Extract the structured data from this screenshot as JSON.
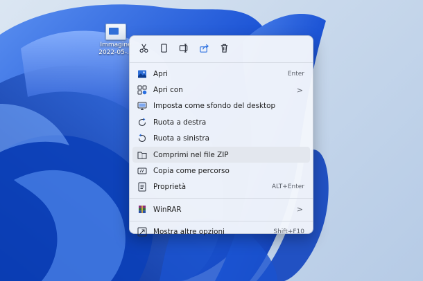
{
  "desktop_icon": {
    "name_line1": "Immagine",
    "name_line2": "2022-05-..."
  },
  "toolbar": [
    {
      "name": "cut-icon"
    },
    {
      "name": "copy-icon"
    },
    {
      "name": "rename-icon"
    },
    {
      "name": "share-icon"
    },
    {
      "name": "delete-icon"
    }
  ],
  "menu": {
    "items": [
      {
        "label": "Apri",
        "shortcut": "Enter",
        "icon": "image-icon"
      },
      {
        "label": "Apri con",
        "submenu": ">",
        "icon": "open-with-icon"
      },
      {
        "label": "Imposta come sfondo del desktop",
        "icon": "wallpaper-icon"
      },
      {
        "label": "Ruota a destra",
        "icon": "rotate-right-icon"
      },
      {
        "label": "Ruota a sinistra",
        "icon": "rotate-left-icon"
      },
      {
        "label": "Comprimi nel file ZIP",
        "icon": "zip-icon"
      },
      {
        "label": "Copia come percorso",
        "icon": "copy-path-icon"
      },
      {
        "label": "Proprietà",
        "shortcut": "ALT+Enter",
        "icon": "properties-icon"
      },
      {
        "label": "WinRAR",
        "submenu": ">",
        "icon": "winrar-icon"
      },
      {
        "label": "Mostra altre opzioni",
        "shortcut": "Shift+F10",
        "icon": "more-options-icon"
      }
    ]
  },
  "colors": {
    "accent": "#1f5fd6",
    "wallpaper_blue": "#0b3fb8",
    "menu_bg": "#f3f6fb",
    "highlight": "#e3e7ee"
  }
}
